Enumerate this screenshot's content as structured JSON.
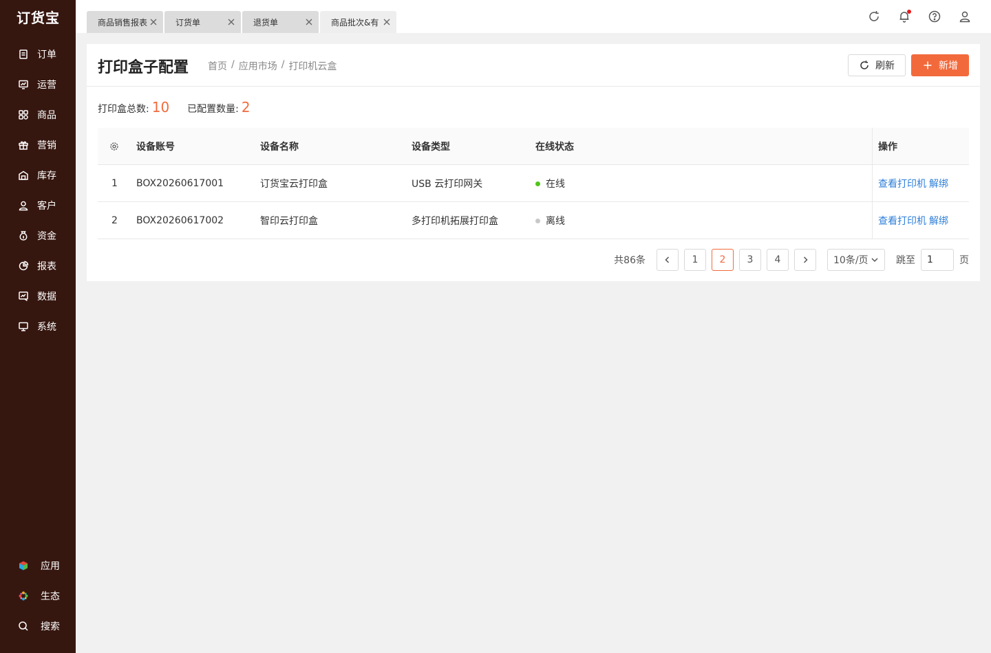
{
  "app": {
    "logo": "订货宝"
  },
  "sidebar": {
    "items": [
      {
        "label": "订单",
        "icon": "order-icon"
      },
      {
        "label": "运营",
        "icon": "operation-icon"
      },
      {
        "label": "商品",
        "icon": "goods-icon"
      },
      {
        "label": "营销",
        "icon": "gift-icon"
      },
      {
        "label": "库存",
        "icon": "warehouse-icon"
      },
      {
        "label": "客户",
        "icon": "user-icon"
      },
      {
        "label": "资金",
        "icon": "money-bag-icon"
      },
      {
        "label": "报表",
        "icon": "pie-chart-icon"
      },
      {
        "label": "数据",
        "icon": "data-icon"
      },
      {
        "label": "系统",
        "icon": "monitor-icon"
      }
    ],
    "bottom_items": [
      {
        "label": "应用",
        "icon": "app-cube-icon"
      },
      {
        "label": "生态",
        "icon": "flower-icon"
      },
      {
        "label": "搜索",
        "icon": "search-icon"
      }
    ]
  },
  "tabs": [
    {
      "label": "商品销售报表"
    },
    {
      "label": "订货单"
    },
    {
      "label": "退货单"
    },
    {
      "label": "商品批次&有"
    }
  ],
  "page": {
    "title": "打印盒子配置",
    "breadcrumb": [
      "首页",
      "应用市场",
      "打印机云盒"
    ],
    "refresh_label": "刷新",
    "add_label": "新增"
  },
  "stats": {
    "total_label": "打印盒总数:",
    "total_value": "10",
    "configured_label": "已配置数量:",
    "configured_value": "2"
  },
  "table": {
    "headers": {
      "account": "设备账号",
      "name": "设备名称",
      "type": "设备类型",
      "status": "在线状态",
      "actions": "操作"
    },
    "rows": [
      {
        "index": "1",
        "account": "BOX20260617001",
        "name": "订货宝云打印盒",
        "type": "USB 云打印网关",
        "status": "在线",
        "status_color": "#52c41a",
        "action_view": "查看打印机",
        "action_unbind": "解绑"
      },
      {
        "index": "2",
        "account": "BOX20260617002",
        "name": "智印云打印盒",
        "type": "多打印机拓展打印盒",
        "status": "离线",
        "status_color": "#c8c8c8",
        "action_view": "查看打印机",
        "action_unbind": "解绑"
      }
    ]
  },
  "pagination": {
    "total": "共86条",
    "pages": [
      "1",
      "2",
      "3",
      "4"
    ],
    "current": "2",
    "page_size": "10条/页",
    "jump_label": "跳至",
    "jump_value": "1",
    "page_suffix": "页"
  },
  "colors": {
    "accent": "#f26a3c",
    "sidebar_bg": "#361710",
    "link": "#2f7fd9"
  }
}
